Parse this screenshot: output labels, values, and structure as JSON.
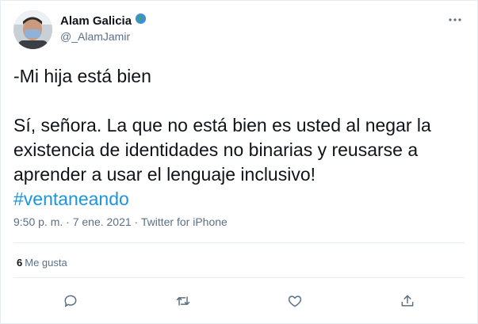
{
  "author": {
    "name": "Alam Galicia",
    "handle": "@_AlamJamir",
    "badge_icon": "globe-americas-icon"
  },
  "tweet": {
    "line1": "-Mi hija está bien",
    "line2": "Sí, señora. La que no está bien es usted al negar la existencia de identidades no binarias y reusarse a aprender a usar el lenguaje inclusivo!",
    "hashtag": "#ventaneando"
  },
  "meta": {
    "timestamp": "9:50 p. m. · 7 ene. 2021",
    "separator": " · ",
    "source": "Twitter for iPhone"
  },
  "stats": {
    "likes_count": "6",
    "likes_label": "Me gusta"
  },
  "actions": [
    "reply-icon",
    "retweet-icon",
    "like-icon",
    "share-icon"
  ],
  "colors": {
    "link": "#1b95e0",
    "secondary_text": "#5b7083",
    "icon": "#5b7083"
  }
}
